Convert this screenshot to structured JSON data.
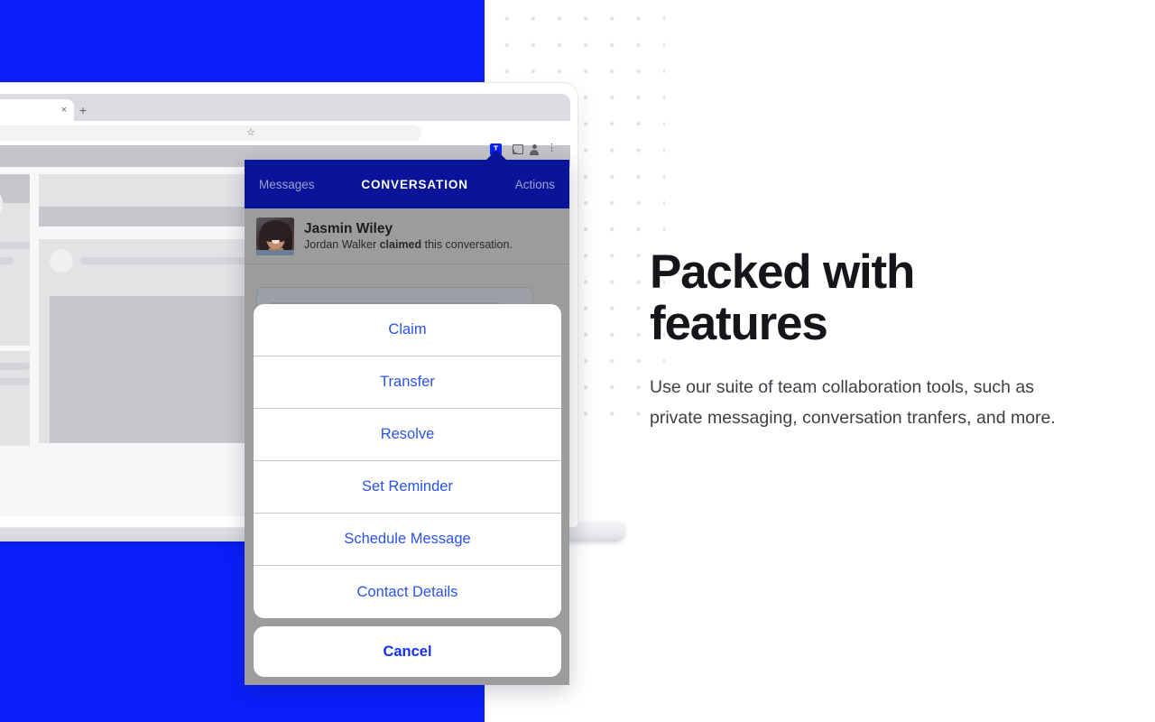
{
  "blocks": {
    "accent_blue": "#0a1ffa",
    "header_navy": "#0a1499",
    "action_link_blue": "#2b52e8"
  },
  "browser": {
    "tab_close_icon": "close-icon",
    "new_tab_icon": "plus-icon",
    "reload_icon": "reload-icon",
    "lock_icon": "lock-icon",
    "star_icon": "star-icon",
    "extension_icon_label": "T",
    "cast_icon": "cast-icon",
    "profile_icon": "profile-icon",
    "menu_icon": "kebab-menu-icon",
    "reload_glyph": "↻",
    "close_glyph": "×",
    "plus_glyph": "+",
    "star_glyph": "☆",
    "menu_glyph": "⋮"
  },
  "popup": {
    "back_label": "Messages",
    "title": "CONVERSATION",
    "actions_label": "Actions",
    "contact": {
      "name": "Jasmin Wiley",
      "status_prefix": "Jordan Walker ",
      "status_bold": "claimed",
      "status_suffix": " this conversation."
    }
  },
  "action_sheet": {
    "items": [
      {
        "label": "Claim"
      },
      {
        "label": "Transfer"
      },
      {
        "label": "Resolve"
      },
      {
        "label": "Set Reminder"
      },
      {
        "label": "Schedule Message"
      },
      {
        "label": "Contact Details"
      }
    ],
    "cancel_label": "Cancel"
  },
  "marketing": {
    "heading": "Packed with features",
    "body": "Use our suite of team collaboration tools, such as private messaging, conversation tranfers, and more."
  }
}
